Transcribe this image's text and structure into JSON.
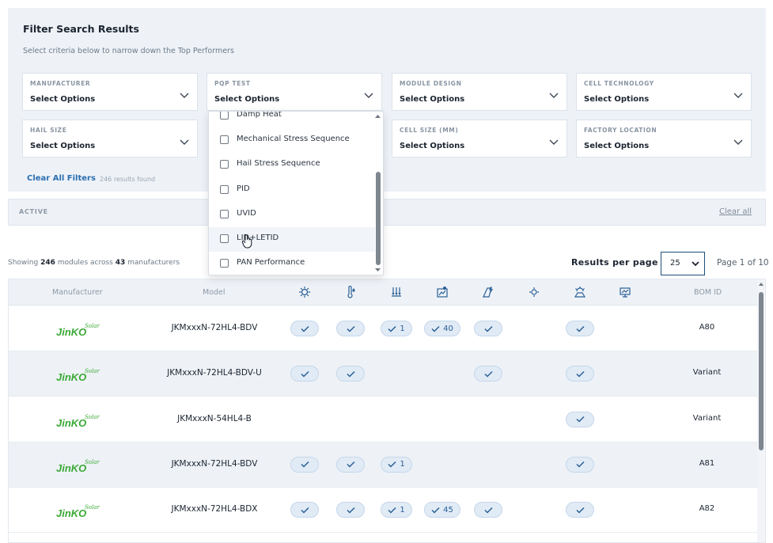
{
  "filters": {
    "title": "Filter Search Results",
    "subtitle": "Select criteria below to narrow down the Top Performers",
    "dropdowns": [
      {
        "label": "MANUFACTURER",
        "value": "Select Options"
      },
      {
        "label": "PQP TEST",
        "value": "Select Options"
      },
      {
        "label": "MODULE DESIGN",
        "value": "Select Options"
      },
      {
        "label": "CELL TECHNOLOGY",
        "value": "Select Options"
      },
      {
        "label": "HAIL SIZE",
        "value": "Select Options"
      },
      {
        "label": "CELL SIZE (MM)",
        "value": "Select Options"
      },
      {
        "label": "FACTORY LOCATION",
        "value": "Select Options"
      }
    ],
    "clear_all_filters": "Clear All Filters",
    "results_found": "246 results found"
  },
  "pqp_options": [
    "Damp Heat",
    "Mechanical Stress Sequence",
    "Hail Stress Sequence",
    "PID",
    "UVID",
    "LID+LETID",
    "PAN Performance"
  ],
  "active": {
    "label": "ACTIVE",
    "clear_all": "Clear all"
  },
  "summary": {
    "showing_prefix": "Showing ",
    "modules_count": "246",
    "middle": " modules across ",
    "manufacturer_count": "43",
    "suffix": " manufacturers",
    "results_per_page_label": "Results per page",
    "results_per_page_value": "25",
    "page_info": "Page 1 of 10"
  },
  "table": {
    "headers": {
      "manufacturer": "Manufacturer",
      "model": "Model",
      "bom": "BOM ID"
    },
    "header_icons": [
      "thermal-cycling-icon",
      "damp-heat-icon",
      "mechanical-stress-icon",
      "hail-icon",
      "pid-icon",
      "lid-icon",
      "uvid-icon",
      "pan-icon"
    ],
    "logo_text": "JinKO",
    "logo_script": "Solar",
    "brand_green": "#3aa935",
    "rows": [
      {
        "model": "JKMxxxN-72HL4-BDV",
        "bom": "A80",
        "tests": [
          {
            "col": 0,
            "text": ""
          },
          {
            "col": 1,
            "text": ""
          },
          {
            "col": 2,
            "text": "1"
          },
          {
            "col": 3,
            "text": "40"
          },
          {
            "col": 4,
            "text": ""
          },
          {
            "col": 6,
            "text": ""
          }
        ]
      },
      {
        "model": "JKMxxxN-72HL4-BDV-U",
        "bom": "Variant",
        "tests": [
          {
            "col": 0,
            "text": ""
          },
          {
            "col": 1,
            "text": ""
          },
          {
            "col": 4,
            "text": ""
          },
          {
            "col": 6,
            "text": ""
          }
        ]
      },
      {
        "model": "JKMxxxN-54HL4-B",
        "bom": "Variant",
        "tests": [
          {
            "col": 6,
            "text": ""
          }
        ]
      },
      {
        "model": "JKMxxxN-72HL4-BDV",
        "bom": "A81",
        "tests": [
          {
            "col": 0,
            "text": ""
          },
          {
            "col": 1,
            "text": ""
          },
          {
            "col": 2,
            "text": "1"
          },
          {
            "col": 6,
            "text": ""
          }
        ]
      },
      {
        "model": "JKMxxxN-72HL4-BDX",
        "bom": "A82",
        "tests": [
          {
            "col": 0,
            "text": ""
          },
          {
            "col": 1,
            "text": ""
          },
          {
            "col": 2,
            "text": "1"
          },
          {
            "col": 3,
            "text": "45"
          },
          {
            "col": 4,
            "text": ""
          },
          {
            "col": 6,
            "text": ""
          }
        ]
      }
    ]
  }
}
